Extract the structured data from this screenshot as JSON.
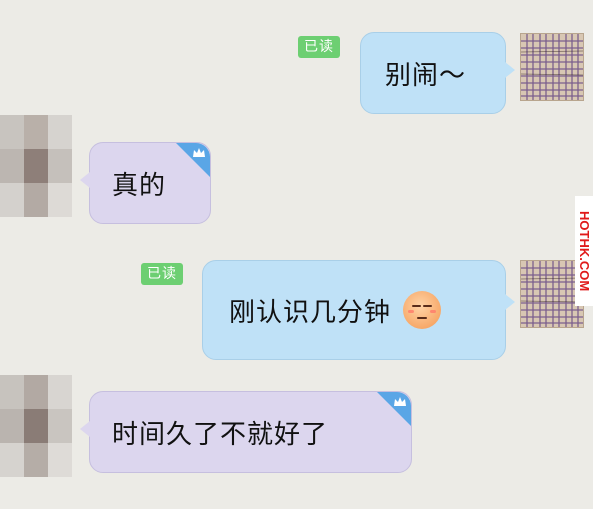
{
  "messages": [
    {
      "direction": "out",
      "text": "别闹～",
      "read_label": "已读"
    },
    {
      "direction": "in",
      "text": "真的"
    },
    {
      "direction": "out",
      "text": "刚认识几分钟",
      "read_label": "已读",
      "emoji": "relieved-face-emoji"
    },
    {
      "direction": "in",
      "text": "时间久了不就好了"
    }
  ],
  "watermark": "HOTHK.COM",
  "colors": {
    "background": "#ecebe6",
    "outgoing_bubble": "#bfe1f7",
    "incoming_bubble": "#dcd6ee",
    "read_badge": "#6dcf72",
    "corner_tag": "#5aa6e6",
    "watermark_text": "#e01a1a"
  }
}
